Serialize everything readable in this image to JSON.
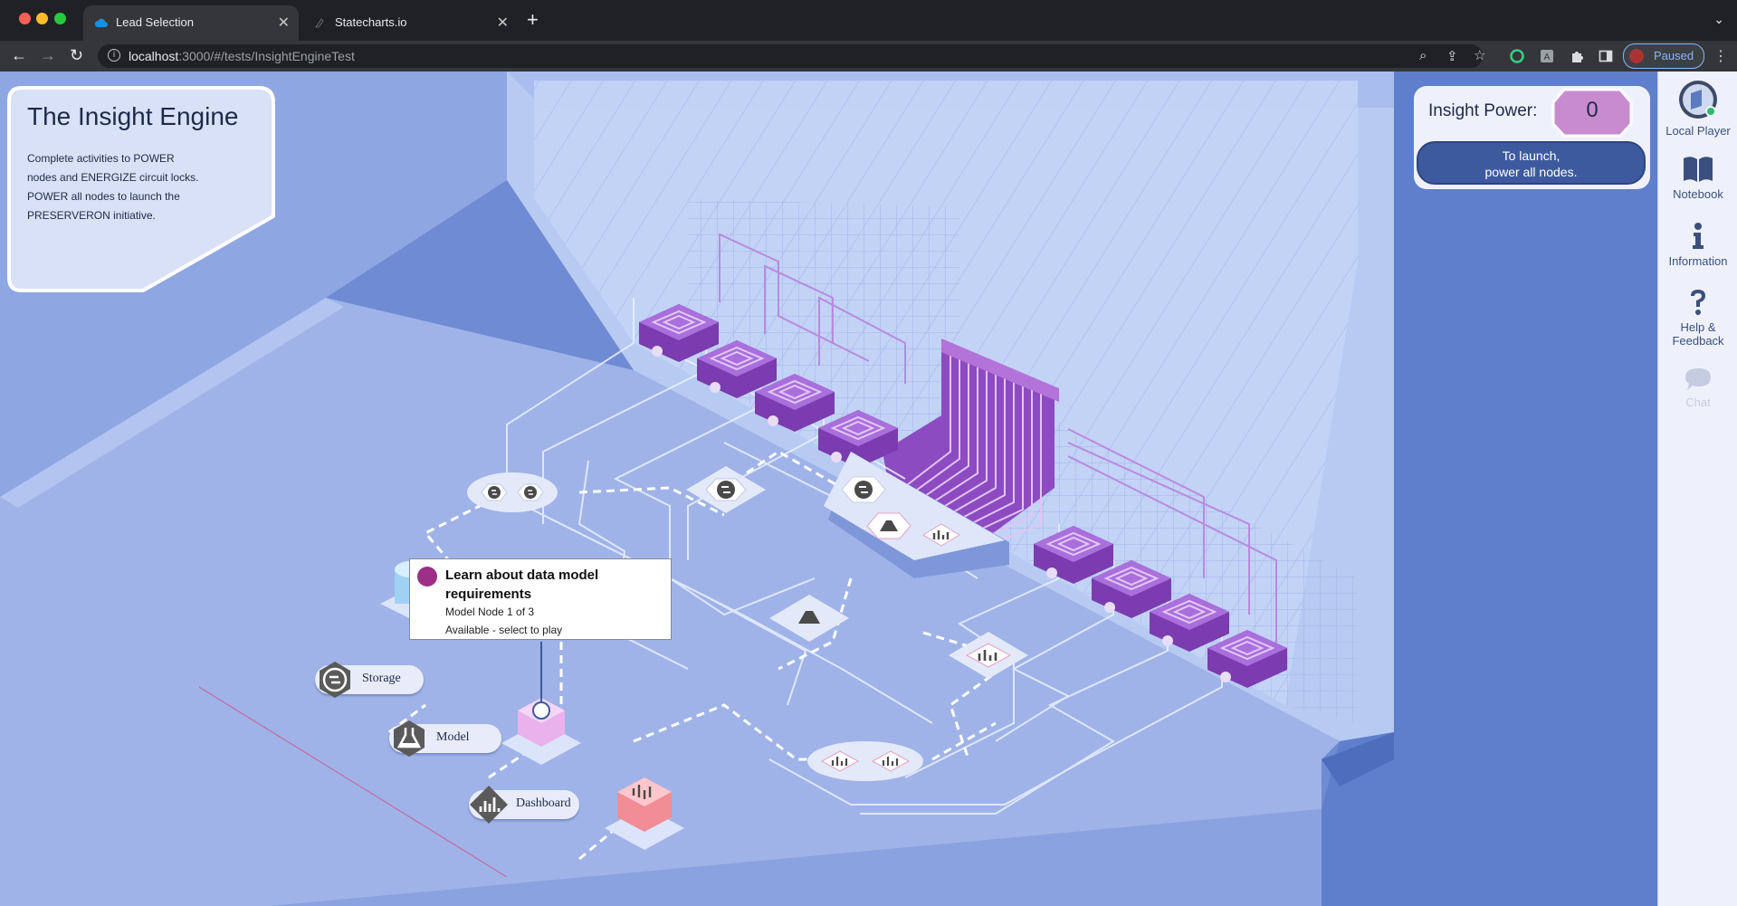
{
  "browser": {
    "tabs": [
      {
        "title": "Lead Selection",
        "favicon": "cloud-icon",
        "active": true
      },
      {
        "title": "Statecharts.io",
        "favicon": "statecharts-icon",
        "active": false
      }
    ],
    "url_host": "localhost",
    "url_path": ":3000/#/tests/InsightEngineTest",
    "profile_label": "Paused"
  },
  "info_panel": {
    "title": "The Insight Engine",
    "lines": [
      "Complete activities to POWER",
      "nodes and ENERGIZE circuit locks.",
      "POWER all nodes to launch the",
      "PRESERVERON initiative."
    ]
  },
  "power_panel": {
    "label": "Insight Power:",
    "value": "0",
    "launch_line1": "To launch,",
    "launch_line2": "power all nodes."
  },
  "tooltip": {
    "title": "Learn about data model requirements",
    "subtitle": "Model Node 1 of 3",
    "status": "Available - select to play"
  },
  "node_labels": [
    {
      "key": "storage",
      "label": "Storage",
      "icon": "storage-icon"
    },
    {
      "key": "model",
      "label": "Model",
      "icon": "model-flask-icon"
    },
    {
      "key": "dashboard",
      "label": "Dashboard",
      "icon": "dashboard-chart-icon"
    }
  ],
  "sidebar": {
    "items": [
      {
        "label": "Local Player",
        "icon": "player-avatar-icon"
      },
      {
        "label": "Notebook",
        "icon": "notebook-icon"
      },
      {
        "label": "Information",
        "icon": "info-icon"
      },
      {
        "label": "Help &",
        "label2": "Feedback",
        "icon": "help-icon"
      },
      {
        "label": "Chat",
        "icon": "chat-icon"
      }
    ]
  },
  "colors": {
    "floor": "#9cb2e6",
    "wall": "#b7caf2",
    "purple_node": "#8e52c2",
    "accent_blue": "#3e5a9e",
    "power_badge": "#c98bd0"
  }
}
